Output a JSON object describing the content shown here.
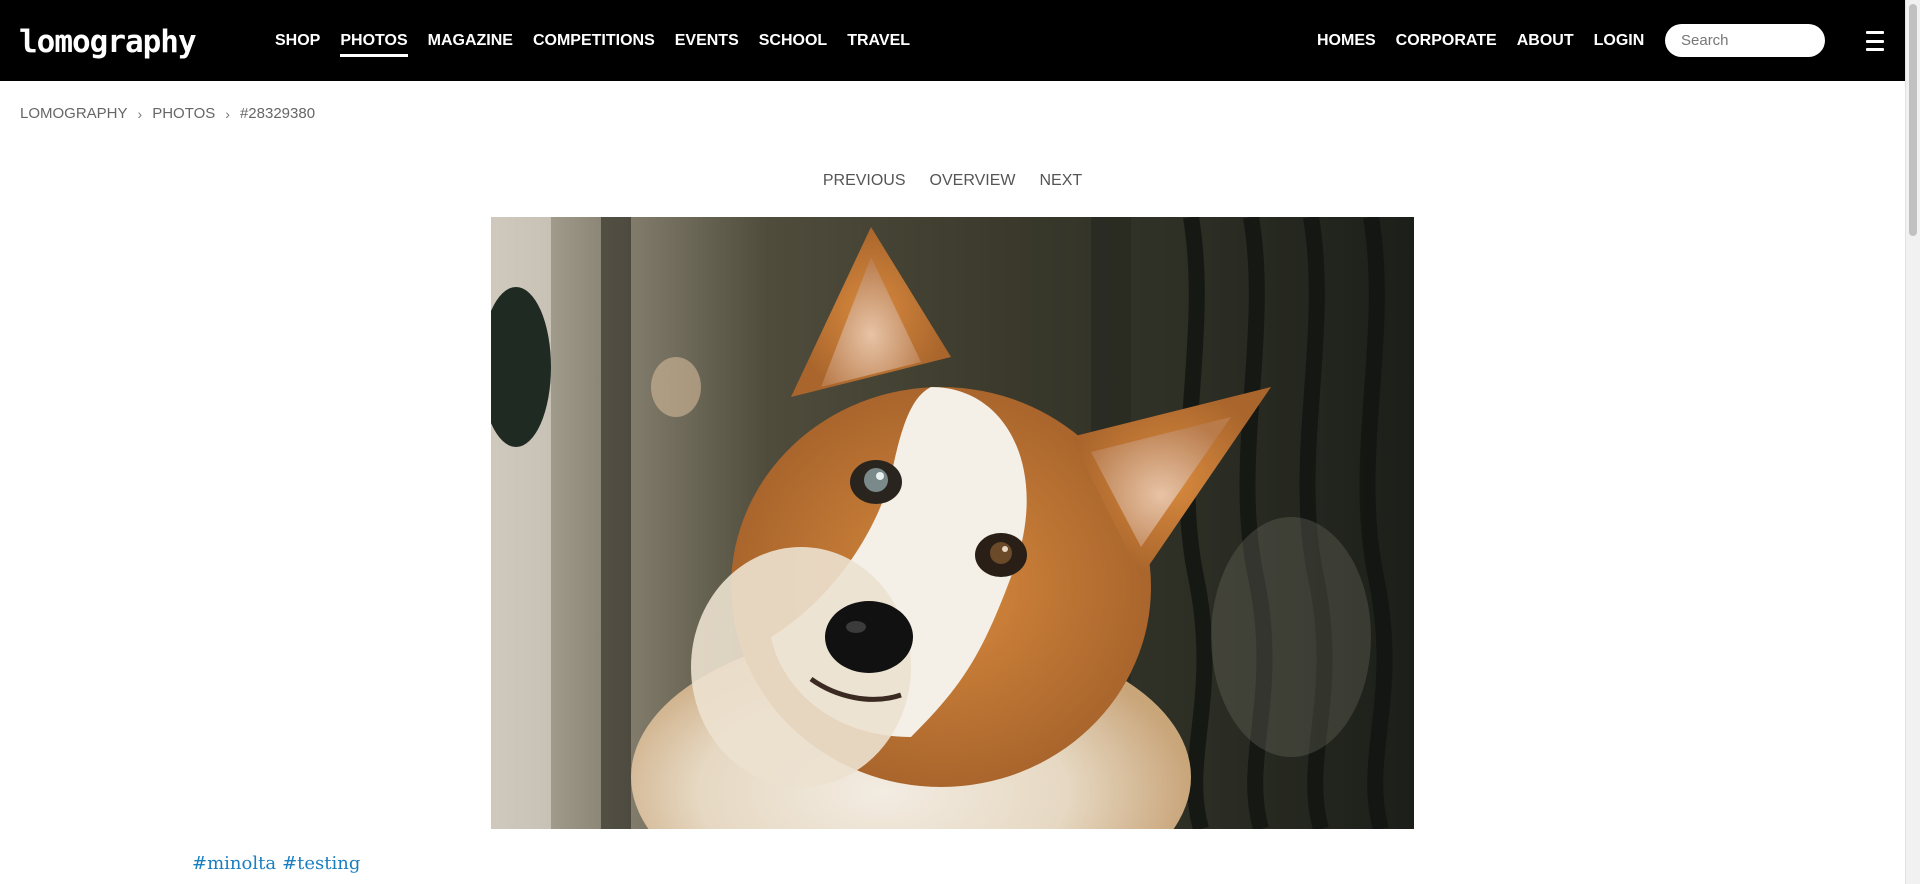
{
  "brand": {
    "logo_text": "lomography"
  },
  "nav": {
    "left": [
      {
        "label": "SHOP",
        "active": false
      },
      {
        "label": "PHOTOS",
        "active": true
      },
      {
        "label": "MAGAZINE",
        "active": false
      },
      {
        "label": "COMPETITIONS",
        "active": false
      },
      {
        "label": "EVENTS",
        "active": false
      },
      {
        "label": "SCHOOL",
        "active": false
      },
      {
        "label": "TRAVEL",
        "active": false
      }
    ],
    "right": [
      {
        "label": "HOMES"
      },
      {
        "label": "CORPORATE"
      },
      {
        "label": "ABOUT"
      },
      {
        "label": "LOGIN"
      }
    ],
    "search_placeholder": "Search",
    "menu_icon": "hamburger-icon"
  },
  "breadcrumb": {
    "items": [
      "LOMOGRAPHY",
      "PHOTOS"
    ],
    "current": "#28329380",
    "separator": "›"
  },
  "photo_nav": {
    "previous": "PREVIOUS",
    "overview": "OVERVIEW",
    "next": "NEXT"
  },
  "photo": {
    "subject": "corgi dog"
  },
  "tags": [
    "#minolta",
    "#testing"
  ],
  "colors": {
    "header_bg": "#000000",
    "tag_link": "#1a7fc1",
    "muted_text": "#666666"
  }
}
